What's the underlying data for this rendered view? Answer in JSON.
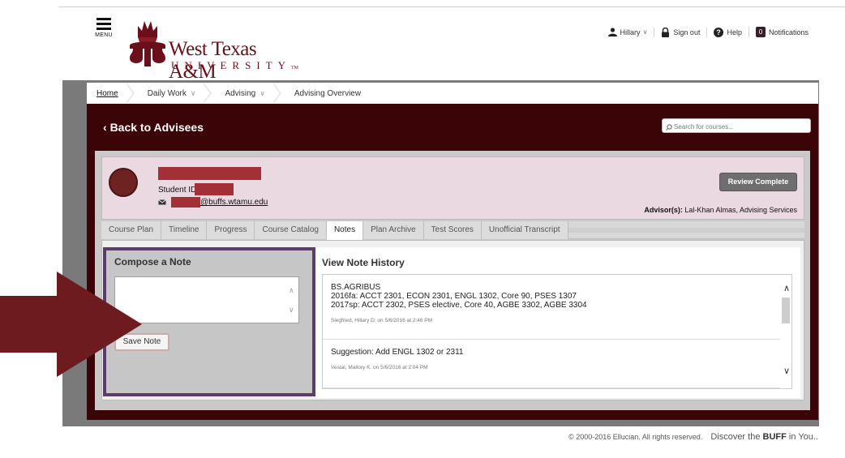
{
  "header": {
    "menu_label": "MENU",
    "logo_main": "West Texas A&M",
    "logo_sub": "UNIVERSITY",
    "logo_tm": "TM"
  },
  "utility_nav": {
    "user_name": "Hillary",
    "sign_out": "Sign out",
    "help": "Help",
    "notifications_count": "0",
    "notifications": "Notifications"
  },
  "breadcrumb": {
    "home": "Home",
    "daily_work": "Daily Work",
    "advising": "Advising",
    "current": "Advising Overview"
  },
  "page": {
    "back_link": "Back to Advisees",
    "search_placeholder": "Search for courses..."
  },
  "student": {
    "id_label": "Student ID:",
    "email_domain": "@buffs.wtamu.edu",
    "review_button": "Review Complete",
    "advisor_label": "Advisor(s):",
    "advisor_value": "Lal-Khan Almas, Advising Services"
  },
  "tabs": [
    {
      "label": "Course Plan"
    },
    {
      "label": "Timeline"
    },
    {
      "label": "Progress"
    },
    {
      "label": "Course Catalog"
    },
    {
      "label": "Notes"
    },
    {
      "label": "Plan Archive"
    },
    {
      "label": "Test Scores"
    },
    {
      "label": "Unofficial Transcript"
    }
  ],
  "compose": {
    "title": "Compose a Note",
    "note_text": "",
    "save_button": "Save Note"
  },
  "history": {
    "title": "View Note History",
    "notes": [
      {
        "lines": [
          "BS.AGRIBUS",
          "2016fa: ACCT 2301, ECON 2301, ENGL 1302, Core 90, PSES 1307",
          "2017sp: ACCT 2302, PSES elective, Core 40, AGBE 3302, AGBE 3304"
        ],
        "meta": "Siegfried, Hillary D. on 5/6/2016 at 2:46 PM"
      },
      {
        "lines": [
          "Suggestion: Add ENGL 1302 or 2311"
        ],
        "meta": "Vestal, Mallory K. on 5/6/2016 at 2:04 PM"
      }
    ]
  },
  "footer": {
    "copyright": "© 2000-2016 Ellucian. All rights reserved.",
    "tagline_pre": "Discover the ",
    "tagline_bold": "BUFF",
    "tagline_post": " in You.."
  },
  "colors": {
    "brand_maroon": "#6b0f1a",
    "dark_maroon": "#3b0508",
    "compose_border": "#5c3c6a",
    "arrow": "#6e1b1f"
  }
}
